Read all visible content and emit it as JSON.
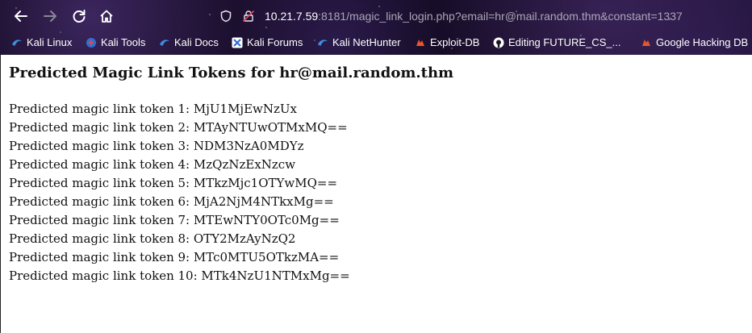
{
  "browser": {
    "url": {
      "host": "10.21.7.59",
      "rest": ":8181/magic_link_login.php?email=hr@mail.random.thm&constant=1337"
    },
    "buttons": {
      "back": "back-icon",
      "forward": "forward-icon",
      "reload": "reload-icon",
      "home": "home-icon"
    },
    "bookmarks": [
      {
        "label": "Kali Linux",
        "icon": "kali-icon"
      },
      {
        "label": "Kali Tools",
        "icon": "kali-tools-icon"
      },
      {
        "label": "Kali Docs",
        "icon": "kali-icon"
      },
      {
        "label": "Kali Forums",
        "icon": "kali-forums-icon"
      },
      {
        "label": "Kali NetHunter",
        "icon": "kali-icon"
      },
      {
        "label": "Exploit-DB",
        "icon": "exploit-db-icon"
      },
      {
        "label": "Editing FUTURE_CS_...",
        "icon": "github-icon"
      },
      {
        "label": "Google Hacking DB",
        "icon": "exploit-db-icon"
      }
    ]
  },
  "page": {
    "title": "Predicted Magic Link Tokens for hr@mail.random.thm",
    "tokens": [
      "Predicted magic link token 1: MjU1MjEwNzUx",
      "Predicted magic link token 2: MTAyNTUwOTMxMQ==",
      "Predicted magic link token 3: NDM3NzA0MDYz",
      "Predicted magic link token 4: MzQzNzExNzcw",
      "Predicted magic link token 5: MTkzMjc1OTYwMQ==",
      "Predicted magic link token 6: MjA2NjM4NTkxMg==",
      "Predicted magic link token 7: MTEwNTY0OTc0Mg==",
      "Predicted magic link token 8: OTY2MzAyNzQ2",
      "Predicted magic link token 9: MTc0MTU5OTkzMA==",
      "Predicted magic link token 10: MTk4NzU1NTMxMg=="
    ]
  }
}
